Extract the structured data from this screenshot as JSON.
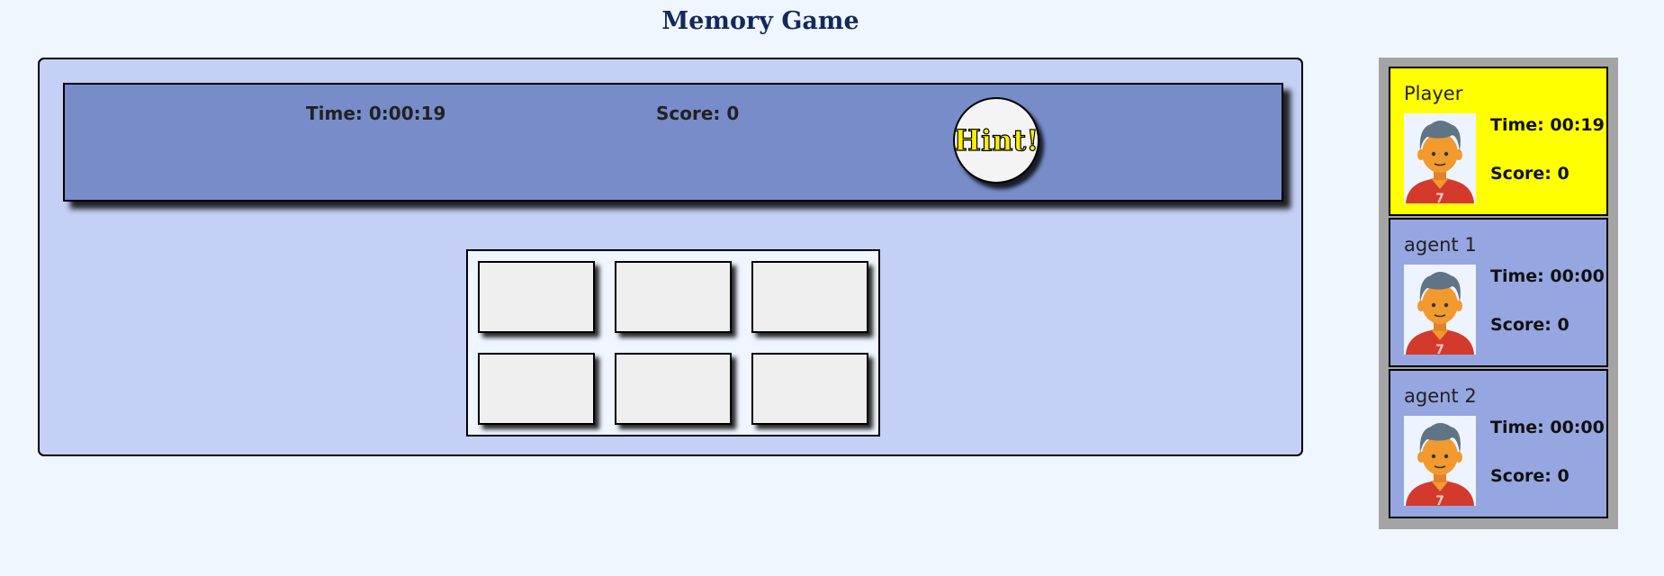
{
  "title": "Memory Game",
  "status_bar": {
    "time_label": "Time: 0:00:19",
    "score_label": "Score: 0",
    "hint_label": "Hint!"
  },
  "cards": [
    {
      "state": "face-down"
    },
    {
      "state": "face-down"
    },
    {
      "state": "face-down"
    },
    {
      "state": "face-down"
    },
    {
      "state": "face-down"
    },
    {
      "state": "face-down"
    }
  ],
  "players": [
    {
      "name": "Player",
      "time": "Time: 00:19",
      "score": "Score: 0",
      "active": true,
      "avatar": "person-avatar-icon"
    },
    {
      "name": "agent 1",
      "time": "Time: 00:00",
      "score": "Score: 0",
      "active": false,
      "avatar": "person-avatar-icon"
    },
    {
      "name": "agent 2",
      "time": "Time: 00:00",
      "score": "Score: 0",
      "active": false,
      "avatar": "person-avatar-icon"
    }
  ],
  "colors": {
    "background": "#eff6fe",
    "board": "#c4d0f5",
    "status_bar": "#778cc9",
    "active_player": "#ffff00",
    "inactive_player": "#95a6e0",
    "title": "#13295b"
  }
}
